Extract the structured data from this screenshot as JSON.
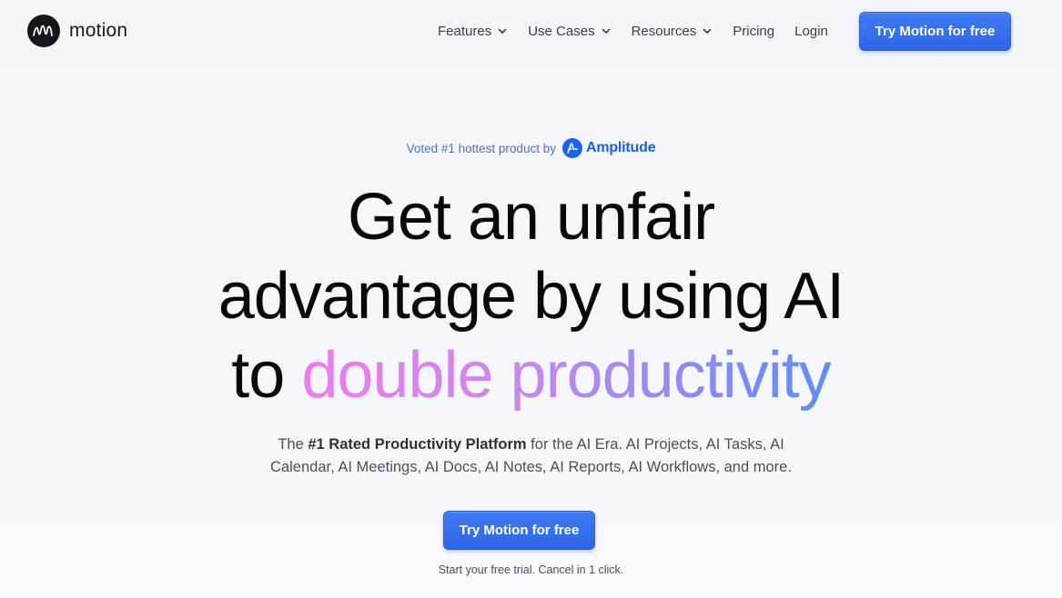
{
  "brand": {
    "name": "motion",
    "logo_icon": "motion-m-icon",
    "colors": {
      "primary": "#3470ec",
      "logo_bg": "#16161e",
      "gradient_start": "#ec7cf0",
      "gradient_end": "#5f8df4"
    }
  },
  "nav": {
    "items": [
      {
        "label": "Features",
        "has_dropdown": true
      },
      {
        "label": "Use Cases",
        "has_dropdown": true
      },
      {
        "label": "Resources",
        "has_dropdown": true
      },
      {
        "label": "Pricing",
        "has_dropdown": false
      },
      {
        "label": "Login",
        "has_dropdown": false
      }
    ],
    "cta_label": "Try Motion for free"
  },
  "hero": {
    "badge": {
      "prefix": "Voted #1 hottest product by",
      "brand": "Amplitude",
      "brand_icon": "amplitude-logo-icon"
    },
    "headline": {
      "line1": "Get an unfair",
      "line2": "advantage by using AI",
      "line3_plain": "to ",
      "line3_gradient": "double productivity"
    },
    "subcopy": {
      "pre": "The ",
      "bold": "#1 Rated Productivity Platform",
      "post": " for the AI Era. AI Projects, AI Tasks, AI",
      "line2": "Calendar, AI Meetings, AI Docs, AI Notes, AI Reports, AI Workflows, and more."
    },
    "cta_label": "Try Motion for free",
    "note": "Start your free trial. Cancel in 1 click."
  }
}
